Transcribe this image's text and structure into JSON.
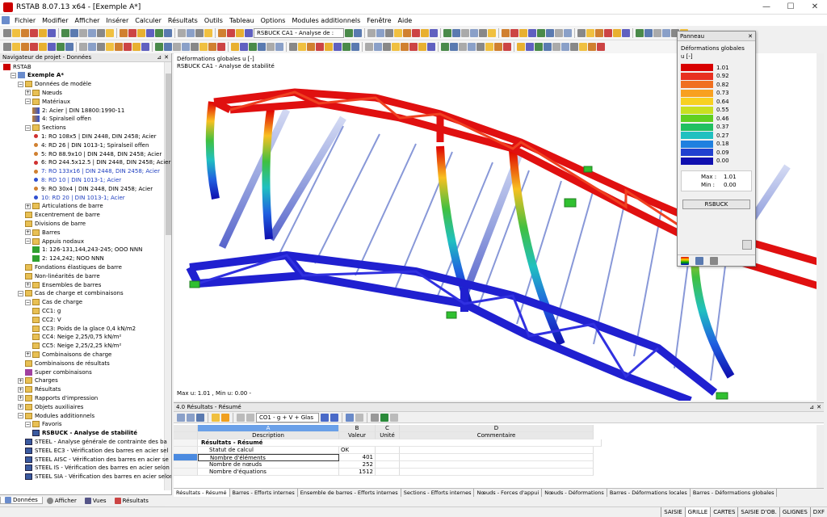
{
  "window": {
    "title": "RSTAB 8.07.13 x64 - [Exemple A*]",
    "min": "—",
    "max": "☐",
    "close": "✕"
  },
  "menu": [
    "Fichier",
    "Modifier",
    "Afficher",
    "Insérer",
    "Calculer",
    "Résultats",
    "Outils",
    "Tableau",
    "Options",
    "Modules additionnels",
    "Fenêtre",
    "Aide"
  ],
  "toolbar": {
    "case_select": "RSBUCK CA1 - Analyse de :"
  },
  "navigator": {
    "title": "Navigateur de projet - Données",
    "items": [
      {
        "label": "RSTAB",
        "indent": 0,
        "icon": "app",
        "bold": false
      },
      {
        "label": "Exemple A*",
        "indent": 1,
        "icon": "model",
        "bold": true,
        "exp": "−"
      },
      {
        "label": "Données de modèle",
        "indent": 2,
        "icon": "folder",
        "exp": "−"
      },
      {
        "label": "Nœuds",
        "indent": 3,
        "icon": "folder",
        "exp": "+"
      },
      {
        "label": "Matériaux",
        "indent": 3,
        "icon": "folder",
        "exp": "−"
      },
      {
        "label": "2: Acier  | DIN 18800:1990-11",
        "indent": 4,
        "icon": "material"
      },
      {
        "label": "4: Spiralseil offen",
        "indent": 4,
        "icon": "material"
      },
      {
        "label": "Sections",
        "indent": 3,
        "icon": "folder",
        "exp": "−"
      },
      {
        "label": "1: RO 108x5 | DIN 2448, DIN 2458; Acier",
        "indent": 4,
        "icon": "bullet",
        "color": "#d03030"
      },
      {
        "label": "4: RD 26 | DIN 1013-1; Spiralseil offen",
        "indent": 4,
        "icon": "bullet",
        "color": "#d08030"
      },
      {
        "label": "5: RO 88.9x10 | DIN 2448, DIN 2458; Acier",
        "indent": 4,
        "icon": "bullet",
        "color": "#d08030"
      },
      {
        "label": "6: RO 244.5x12.5 | DIN 2448, DIN 2458; Acier",
        "indent": 4,
        "icon": "bullet",
        "color": "#d03030"
      },
      {
        "label": "7: RO 133x16 | DIN 2448, DIN 2458; Acier",
        "indent": 4,
        "icon": "bullet",
        "color": "#d08030",
        "blue": true
      },
      {
        "label": "8: RD 10 | DIN 1013-1; Acier",
        "indent": 4,
        "icon": "bullet",
        "color": "#3050d0",
        "blue": true
      },
      {
        "label": "9: RO 30x4 | DIN 2448, DIN 2458; Acier",
        "indent": 4,
        "icon": "bullet",
        "color": "#d08030"
      },
      {
        "label": "10: RD 20 | DIN 1013-1; Acier",
        "indent": 4,
        "icon": "bullet",
        "color": "#3050d0",
        "blue": true
      },
      {
        "label": "Articulations de barre",
        "indent": 3,
        "icon": "folder",
        "exp": "+"
      },
      {
        "label": "Excentrement de barre",
        "indent": 3,
        "icon": "folder"
      },
      {
        "label": "Divisions de barre",
        "indent": 3,
        "icon": "folder"
      },
      {
        "label": "Barres",
        "indent": 3,
        "icon": "folder",
        "exp": "+"
      },
      {
        "label": "Appuis nodaux",
        "indent": 3,
        "icon": "folder",
        "exp": "−"
      },
      {
        "label": "1: 126-131,144,243-245; OOO NNN",
        "indent": 4,
        "icon": "support"
      },
      {
        "label": "2: 124,242; NOO NNN",
        "indent": 4,
        "icon": "support"
      },
      {
        "label": "Fondations élastiques de barre",
        "indent": 3,
        "icon": "folder"
      },
      {
        "label": "Non-linéarités de barre",
        "indent": 3,
        "icon": "folder"
      },
      {
        "label": "Ensembles de barres",
        "indent": 3,
        "icon": "folder",
        "exp": "+"
      },
      {
        "label": "Cas de charge et combinaisons",
        "indent": 2,
        "icon": "folder",
        "exp": "−"
      },
      {
        "label": "Cas de charge",
        "indent": 3,
        "icon": "folder",
        "exp": "−"
      },
      {
        "label": "CC1: g",
        "indent": 4,
        "icon": "folder"
      },
      {
        "label": "CC2: V",
        "indent": 4,
        "icon": "folder"
      },
      {
        "label": "CC3: Poids de la glace 0,4 kN/m2",
        "indent": 4,
        "icon": "folder"
      },
      {
        "label": "CC4: Neige 2,25/0,75 kN/m²",
        "indent": 4,
        "icon": "folder"
      },
      {
        "label": "CC5: Neige 2,25/2,25 kN/m²",
        "indent": 4,
        "icon": "folder"
      },
      {
        "label": "Combinaisons de charge",
        "indent": 3,
        "icon": "folder",
        "exp": "+"
      },
      {
        "label": "Combinaisons de résultats",
        "indent": 3,
        "icon": "folder"
      },
      {
        "label": "Super combinaisons",
        "indent": 3,
        "icon": "combo"
      },
      {
        "label": "Charges",
        "indent": 2,
        "icon": "folder",
        "exp": "+"
      },
      {
        "label": "Résultats",
        "indent": 2,
        "icon": "folder",
        "exp": "+"
      },
      {
        "label": "Rapports d'impression",
        "indent": 2,
        "icon": "folder",
        "exp": "+"
      },
      {
        "label": "Objets auxiliaires",
        "indent": 2,
        "icon": "folder",
        "exp": "+"
      },
      {
        "label": "Modules additionnels",
        "indent": 2,
        "icon": "folder",
        "exp": "−"
      },
      {
        "label": "Favoris",
        "indent": 3,
        "icon": "folder",
        "exp": "−"
      },
      {
        "label": "RSBUCK - Analyse de stabilité",
        "indent": 4,
        "icon": "module",
        "bold": true
      },
      {
        "label": "STEEL - Analyse générale de contrainte des ba",
        "indent": 3,
        "icon": "module"
      },
      {
        "label": "STEEL EC3 - Vérification des barres en acier sel",
        "indent": 3,
        "icon": "module"
      },
      {
        "label": "STEEL AISC - Vérification des barres en acier se",
        "indent": 3,
        "icon": "module"
      },
      {
        "label": "STEEL IS - Vérification des barres en acier selon",
        "indent": 3,
        "icon": "module"
      },
      {
        "label": "STEEL SIA - Vérification des barres en acier selon",
        "indent": 3,
        "icon": "module"
      }
    ],
    "tabs": [
      "Données",
      "Afficher",
      "Vues",
      "Résultats"
    ]
  },
  "view": {
    "line1": "Déformations globales u [-]",
    "line2": "RSBUCK CA1 - Analyse de stabilité",
    "footer": "Max u: 1.01 , Min u: 0.00 -"
  },
  "panel": {
    "title": "Panneau",
    "heading": "Déformations globales",
    "unit": "u [-]",
    "legend": [
      {
        "v": "1.01",
        "c": "#d80000"
      },
      {
        "v": "0.92",
        "c": "#e83020"
      },
      {
        "v": "0.82",
        "c": "#f07020"
      },
      {
        "v": "0.73",
        "c": "#f8a020"
      },
      {
        "v": "0.64",
        "c": "#f8d020"
      },
      {
        "v": "0.55",
        "c": "#c8e020"
      },
      {
        "v": "0.46",
        "c": "#60d020"
      },
      {
        "v": "0.37",
        "c": "#20c060"
      },
      {
        "v": "0.27",
        "c": "#20c0c0"
      },
      {
        "v": "0.18",
        "c": "#2080e0"
      },
      {
        "v": "0.09",
        "c": "#2040d0"
      },
      {
        "v": "0.00",
        "c": "#1010b0"
      }
    ],
    "max_label": "Max :",
    "max_val": "1.01",
    "min_label": "Min :",
    "min_val": "0.00",
    "button": "RSBUCK"
  },
  "results": {
    "title": "4.0 Résultats - Résumé",
    "combo": "CO1 - g + V + Glas",
    "col_letters": [
      "A",
      "B",
      "C",
      "D"
    ],
    "col_headers": [
      "Description",
      "Valeur",
      "Unité",
      "Commentaire"
    ],
    "section": "Résultats - Résumé",
    "rows": [
      {
        "d": "Statut de calcul",
        "v": "OK",
        "u": "",
        "c": ""
      },
      {
        "d": "Nombre d'éléments",
        "v": "401",
        "u": "",
        "c": ""
      },
      {
        "d": "Nombre de nœuds",
        "v": "252",
        "u": "",
        "c": ""
      },
      {
        "d": "Nombre d'équations",
        "v": "1512",
        "u": "",
        "c": ""
      }
    ],
    "tabs": [
      "Résultats - Résumé",
      "Barres - Efforts internes",
      "Ensemble de barres - Efforts internes",
      "Sections - Efforts internes",
      "Nœuds - Forces d'appui",
      "Nœuds - Déformations",
      "Barres - Déformations locales",
      "Barres - Déformations globales"
    ]
  },
  "status": [
    "SAISIE",
    "GRILLE",
    "CARTES",
    "SAISIE D'OB.",
    "GLIGNES",
    "DXF"
  ]
}
